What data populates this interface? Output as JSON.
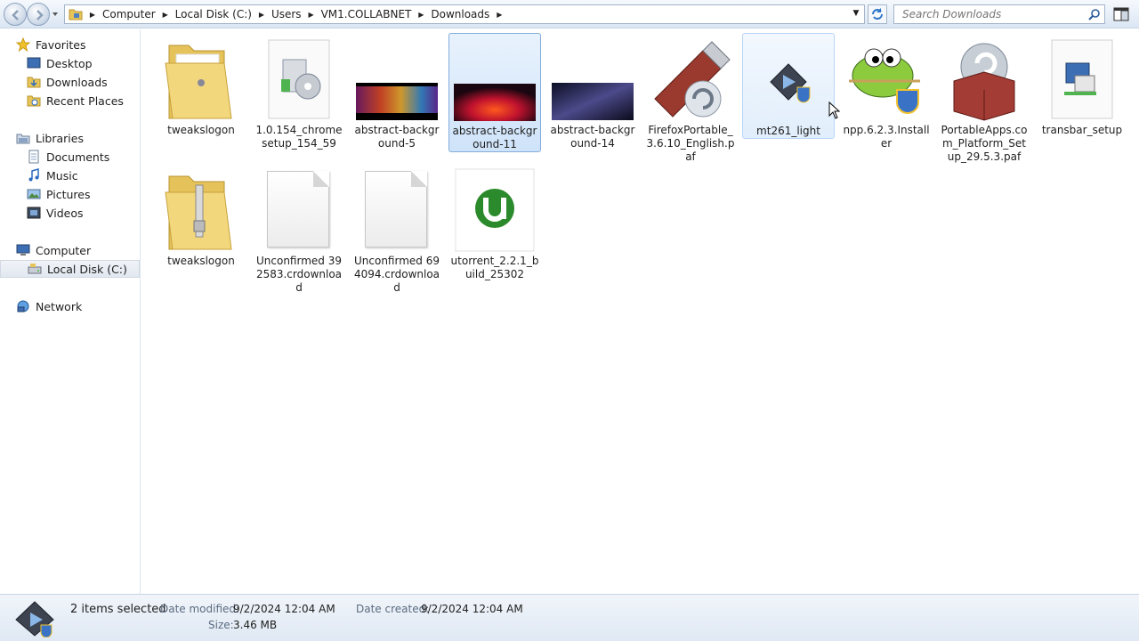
{
  "address": {
    "breadcrumbs": [
      "Computer",
      "Local Disk (C:)",
      "Users",
      "VM1.COLLABNET",
      "Downloads"
    ]
  },
  "search": {
    "placeholder": "Search Downloads"
  },
  "nav": {
    "favorites": {
      "label": "Favorites",
      "items": [
        "Desktop",
        "Downloads",
        "Recent Places"
      ]
    },
    "libraries": {
      "label": "Libraries",
      "items": [
        "Documents",
        "Music",
        "Pictures",
        "Videos"
      ]
    },
    "computer": {
      "label": "Computer",
      "items": [
        "Local Disk (C:)"
      ]
    },
    "network": {
      "label": "Network"
    }
  },
  "files": [
    {
      "name": "tweakslogon",
      "icon": "folder-icon"
    },
    {
      "name": "1.0.154_chromesetup_154_59",
      "icon": "installer-disc-icon"
    },
    {
      "name": "abstract-background-5",
      "icon": "image-thumbnail"
    },
    {
      "name": "abstract-background-11",
      "icon": "image-thumbnail",
      "selected": true
    },
    {
      "name": "abstract-background-14",
      "icon": "image-thumbnail"
    },
    {
      "name": "FirefoxPortable_3.6.10_English.paf",
      "icon": "usb-drive-icon"
    },
    {
      "name": "mt261_light",
      "icon": "shield-app-icon",
      "hovered": true
    },
    {
      "name": "npp.6.2.3.Installer",
      "icon": "notepadpp-icon"
    },
    {
      "name": "PortableApps.com_Platform_Setup_29.5.3.paf",
      "icon": "package-box-icon"
    },
    {
      "name": "transbar_setup",
      "icon": "setup-computer-icon"
    },
    {
      "name": "tweakslogon",
      "icon": "zip-folder-icon"
    },
    {
      "name": "Unconfirmed 392583.crdownload",
      "icon": "blank-file-icon"
    },
    {
      "name": "Unconfirmed 694094.crdownload",
      "icon": "blank-file-icon"
    },
    {
      "name": "utorrent_2.2.1_build_25302",
      "icon": "utorrent-icon"
    }
  ],
  "status": {
    "selection": "2 items selected",
    "date_modified_label": "Date modified:",
    "date_modified": "9/2/2024 12:04 AM",
    "date_created_label": "Date created:",
    "date_created": "9/2/2024 12:04 AM",
    "size_label": "Size:",
    "size": "3.46 MB"
  }
}
